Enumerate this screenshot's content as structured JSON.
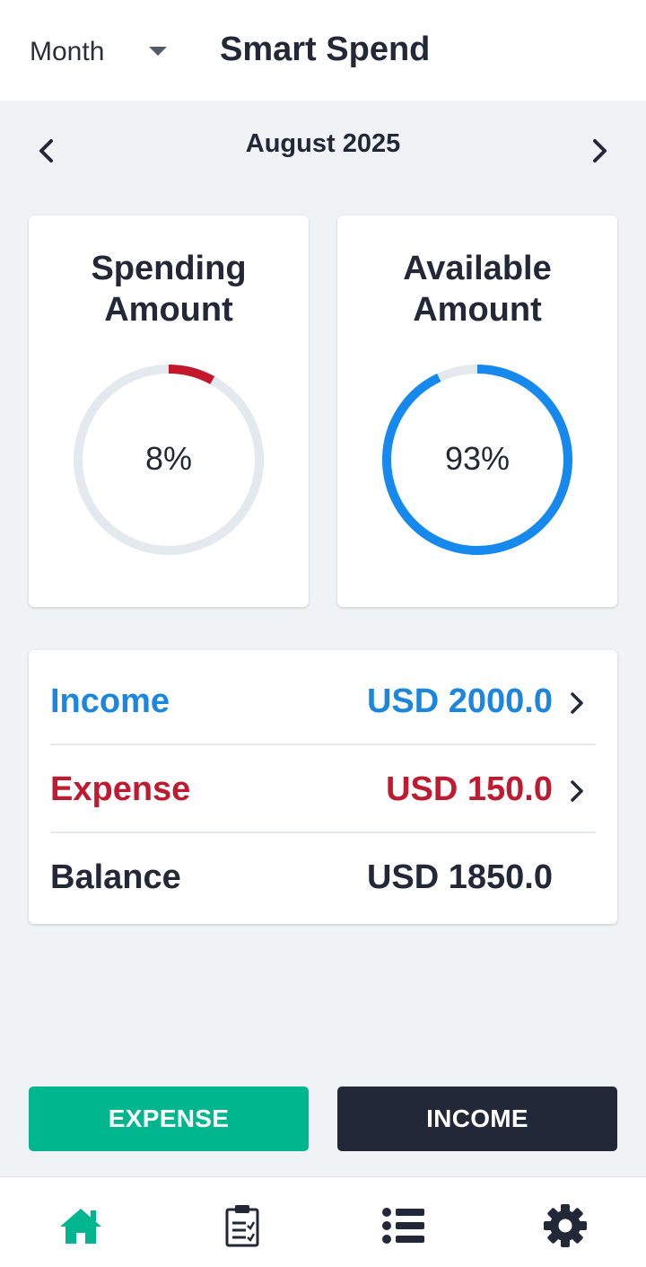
{
  "header": {
    "period_label": "Month",
    "title": "Smart Spend"
  },
  "month_nav": {
    "current": "August 2025",
    "prev_icon": "chevron-left-icon",
    "next_icon": "chevron-right-icon"
  },
  "gauges": {
    "spending": {
      "title_line1": "Spending",
      "title_line2": "Amount",
      "percent_label": "8%",
      "fraction": 0.08,
      "color": "#c4172c",
      "track_color": "#e3e9ef"
    },
    "available": {
      "title_line1": "Available",
      "title_line2": "Amount",
      "percent_label": "93%",
      "fraction": 0.93,
      "color": "#1589ee",
      "track_color": "#e3e9ef"
    }
  },
  "summary": {
    "income": {
      "label": "Income",
      "value": "USD 2000.0",
      "color": "#1b86de"
    },
    "expense": {
      "label": "Expense",
      "value": "USD 150.0",
      "color": "#c01a30"
    },
    "balance": {
      "label": "Balance",
      "value": "USD 1850.0",
      "color": "#222838"
    }
  },
  "actions": {
    "expense_label": "EXPENSE",
    "income_label": "INCOME",
    "expense_color": "#00b68e",
    "income_color": "#222838"
  },
  "bottom_nav": {
    "tabs": [
      {
        "icon": "home-icon",
        "active": true
      },
      {
        "icon": "clipboard-icon",
        "active": false
      },
      {
        "icon": "list-icon",
        "active": false
      },
      {
        "icon": "gear-icon",
        "active": false
      }
    ],
    "active_color": "#00b68e",
    "inactive_color": "#222838"
  }
}
